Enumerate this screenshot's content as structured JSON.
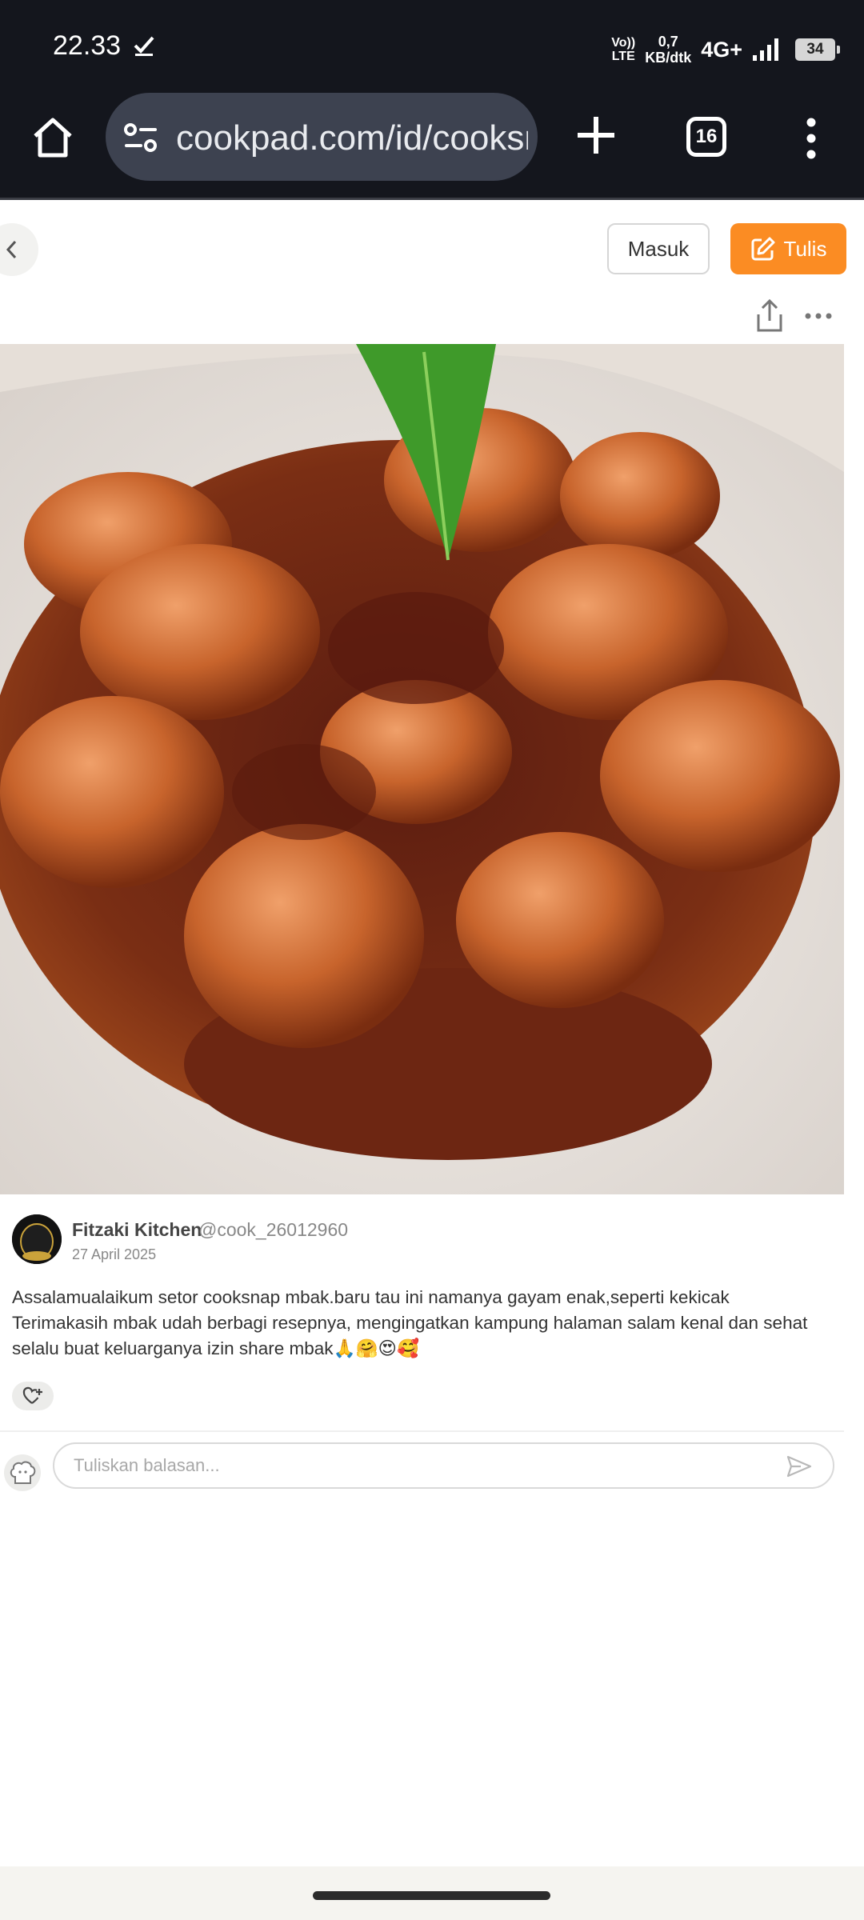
{
  "status_bar": {
    "time": "22.33",
    "volte_line1": "Vo))",
    "volte_line2": "LTE",
    "speed_value": "0,7",
    "speed_unit": "KB/dtk",
    "network": "4G+",
    "battery": "34"
  },
  "browser": {
    "url": "cookpad.com/id/cooksnaps",
    "tab_count": "16",
    "icons": [
      "home-icon",
      "site-settings-icon",
      "plus-icon",
      "more-vert-icon"
    ]
  },
  "header": {
    "login_label": "Masuk",
    "write_label": "Tulis",
    "accent_color": "#fb8c23"
  },
  "post": {
    "author_name": "Fitzaki Kitchen",
    "author_handle": "@cook_26012960",
    "date": "27 April 2025",
    "text_line1": "Assalamualaikum setor cooksnap mbak.baru tau ini namanya gayam enak,seperti kekicak",
    "text_line2": "Terimakasih mbak udah berbagi resepnya, mengingatkan kampung halaman salam kenal dan sehat",
    "text_line3": "selalu buat keluarganya izin share mbak🙏🤗😍🥰"
  },
  "reply": {
    "placeholder": "Tuliskan balasan..."
  }
}
